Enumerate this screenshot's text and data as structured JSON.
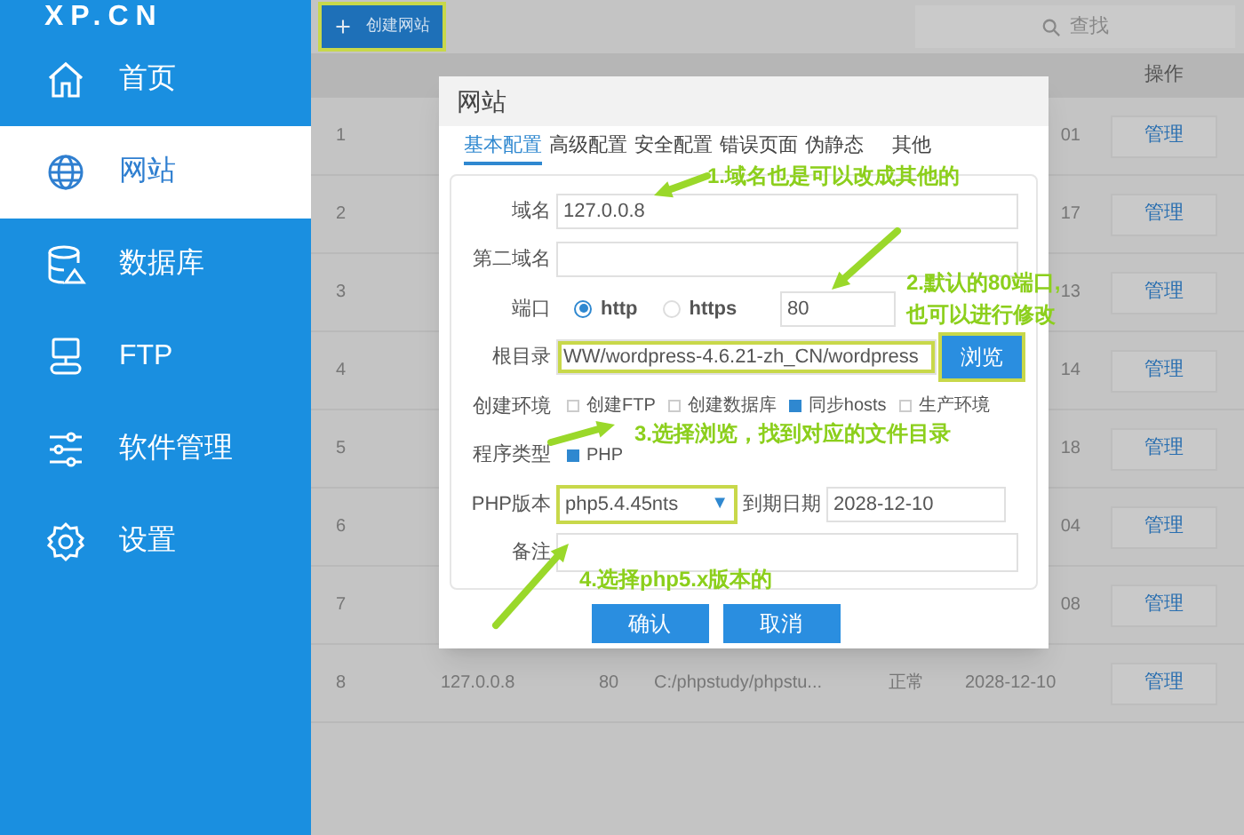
{
  "sidebar": {
    "logo": "XP.CN",
    "items": [
      {
        "label": "首页",
        "selected": false
      },
      {
        "label": "网站",
        "selected": true
      },
      {
        "label": "数据库",
        "selected": false
      },
      {
        "label": "FTP",
        "selected": false
      },
      {
        "label": "软件管理",
        "selected": false
      },
      {
        "label": "设置",
        "selected": false
      }
    ]
  },
  "toolbar": {
    "create_button": {
      "label": "创建网站",
      "highlighted": true
    },
    "search": {
      "placeholder": "查找"
    }
  },
  "table": {
    "columns": [
      {
        "label": "操作"
      }
    ],
    "rows": [
      {
        "number": "1",
        "date": "01",
        "action": "管理"
      },
      {
        "number": "2",
        "date": "17",
        "action": "管理"
      },
      {
        "number": "3",
        "date": "13",
        "action": "管理"
      },
      {
        "number": "4",
        "date": "14",
        "action": "管理"
      },
      {
        "number": "5",
        "date": "18",
        "action": "管理"
      },
      {
        "number": "6",
        "date": "04",
        "action": "管理"
      },
      {
        "number": "7",
        "date": "08",
        "action": "管理"
      },
      {
        "number": "8",
        "domain": "127.0.0.8",
        "port": "80",
        "path": "C:/phpstudy/phpstu...",
        "status": "正常",
        "date": "2028-12-10",
        "action": "管理"
      }
    ]
  },
  "dialog": {
    "title": "网站",
    "tabs": [
      {
        "label": "基本配置",
        "selected": true
      },
      {
        "label": "高级配置",
        "selected": false
      },
      {
        "label": "安全配置",
        "selected": false
      },
      {
        "label": "错误页面",
        "selected": false
      },
      {
        "label": "伪静态",
        "selected": false
      },
      {
        "label": "其他",
        "selected": false
      }
    ],
    "domain": {
      "label": "域名",
      "value": "127.0.0.8"
    },
    "second_domain": {
      "label": "第二域名"
    },
    "port": {
      "label": "端口",
      "options": [
        {
          "label": "http",
          "selected": true
        },
        {
          "label": "https",
          "selected": false
        }
      ],
      "value": "80"
    },
    "root_dir": {
      "label": "根目录",
      "value": "WW/wordpress-4.6.21-zh_CN/wordpress",
      "highlighted": true,
      "browse": {
        "label": "浏览",
        "highlighted": true
      }
    },
    "environment": {
      "label": "创建环境",
      "options": [
        {
          "label": "创建FTP",
          "checked": false
        },
        {
          "label": "创建数据库",
          "checked": false
        },
        {
          "label": "同步hosts",
          "checked": true
        },
        {
          "label": "生产环境",
          "checked": false
        }
      ]
    },
    "program_type": {
      "label": "程序类型",
      "options": [
        {
          "label": "PHP",
          "checked": true
        }
      ]
    },
    "php_version": {
      "label": "PHP版本",
      "value": "php5.4.45nts",
      "arrow": "▼",
      "highlighted": true
    },
    "expiry": {
      "label": "到期日期",
      "value": "2028-12-10"
    },
    "note": {
      "label": "备注"
    },
    "buttons": [
      "确认",
      "取消"
    ]
  },
  "annotations": [
    {
      "text": "1.域名也是可以改成其他的"
    },
    {
      "text": "2.默认的80端口,\n也可以进行修改"
    },
    {
      "text": "3.选择浏览，找到对应的文件目录"
    },
    {
      "text": "4.选择php5.x版本的"
    }
  ]
}
